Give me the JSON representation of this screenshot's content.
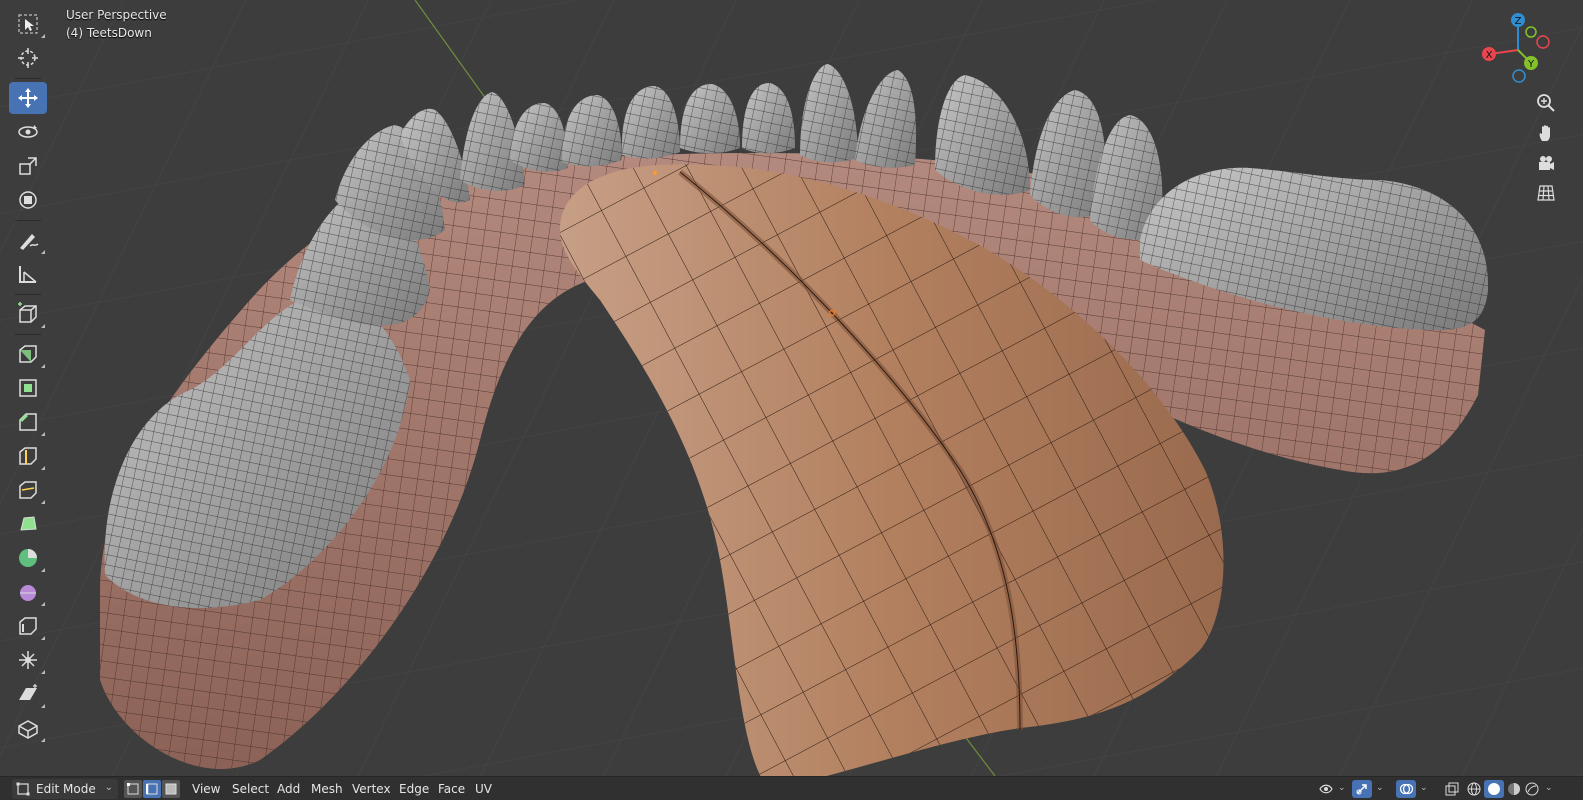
{
  "viewport": {
    "title": "User Perspective",
    "object": "(4) TeetsDown"
  },
  "toolbar": {
    "tools": [
      {
        "name": "select-box-icon",
        "active": false
      },
      {
        "name": "cursor-icon",
        "active": false
      },
      {
        "name": "move-icon",
        "active": true
      },
      {
        "name": "rotate-icon",
        "active": false
      },
      {
        "name": "scale-icon",
        "active": false
      },
      {
        "name": "transform-icon",
        "active": false
      },
      {
        "name": "annotate-icon",
        "active": false
      },
      {
        "name": "measure-icon",
        "active": false
      },
      {
        "name": "add-cube-icon",
        "active": false
      },
      {
        "name": "extrude-icon",
        "active": false
      },
      {
        "name": "inset-icon",
        "active": false
      },
      {
        "name": "bevel-icon",
        "active": false
      },
      {
        "name": "loop-cut-icon",
        "active": false
      },
      {
        "name": "knife-icon",
        "active": false
      },
      {
        "name": "poly-build-icon",
        "active": false
      },
      {
        "name": "spin-icon",
        "active": false
      },
      {
        "name": "smooth-icon",
        "active": false
      },
      {
        "name": "edge-slide-icon",
        "active": false
      },
      {
        "name": "shrink-fatten-icon",
        "active": false
      },
      {
        "name": "shear-icon",
        "active": false
      },
      {
        "name": "rip-icon",
        "active": false
      }
    ]
  },
  "gizmo": {
    "x_label": "X",
    "y_label": "Y",
    "z_label": "Z",
    "colors": {
      "x": "#e8454f",
      "y": "#84c22b",
      "z": "#2f8ed3"
    }
  },
  "header": {
    "mode": "Edit Mode",
    "menus": [
      "View",
      "Select",
      "Add",
      "Mesh",
      "Vertex",
      "Edge",
      "Face",
      "UV"
    ]
  },
  "colors": {
    "background": "#3d3d3d",
    "header": "#303030",
    "accent": "#4772b3",
    "teeth": "#9a9a9a",
    "gum": "#a47a6e",
    "tongue": "#b07e63"
  }
}
